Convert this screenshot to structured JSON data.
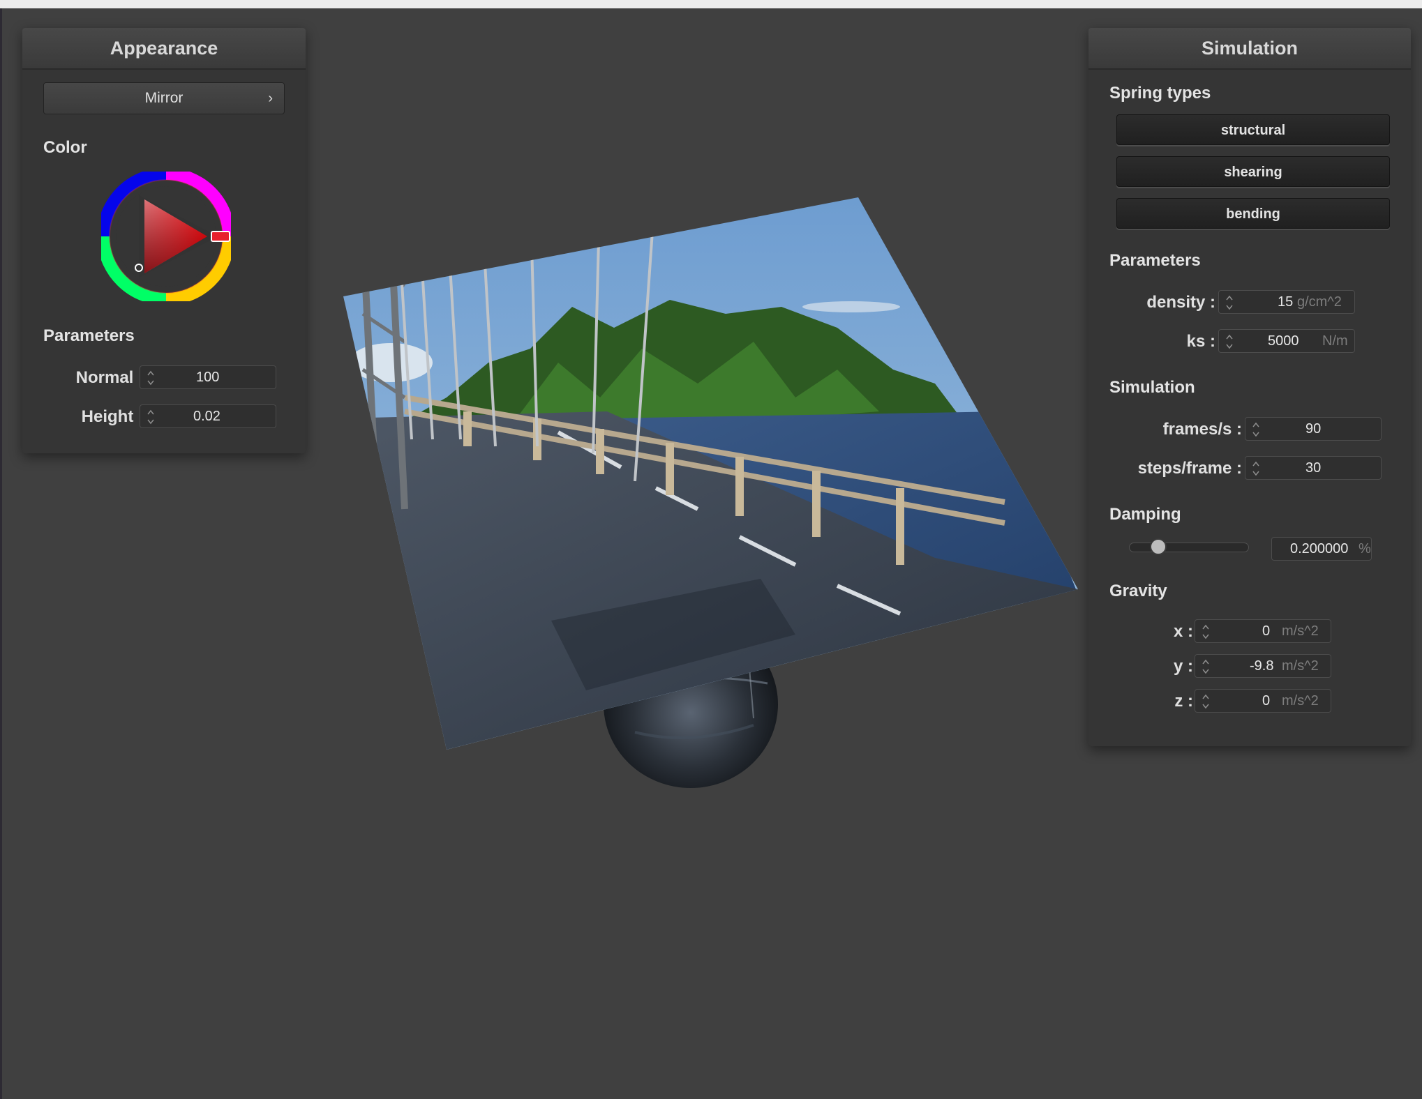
{
  "appearance": {
    "title": "Appearance",
    "material_dropdown": "Mirror",
    "color_label": "Color",
    "selected_color": "#ff0000",
    "parameters_label": "Parameters",
    "normal": {
      "label": "Normal :",
      "value": "100"
    },
    "height": {
      "label": "Height :",
      "value": "0.02"
    }
  },
  "simulation": {
    "title": "Simulation",
    "spring_types_label": "Spring types",
    "spring_buttons": [
      "structural",
      "shearing",
      "bending"
    ],
    "parameters_label": "Parameters",
    "density": {
      "label": "density :",
      "value": "15",
      "unit": "g/cm^2"
    },
    "ks": {
      "label": "ks :",
      "value": "5000",
      "unit": "N/m"
    },
    "sim_label": "Simulation",
    "frames_per_second": {
      "label": "frames/s :",
      "value": "90"
    },
    "steps_per_frame": {
      "label": "steps/frame :",
      "value": "30"
    },
    "damping_label": "Damping",
    "damping": {
      "value": "0.200000",
      "unit": "%",
      "fraction": 0.2
    },
    "gravity_label": "Gravity",
    "gravity": {
      "x": {
        "label": "x :",
        "value": "0",
        "unit": "m/s^2"
      },
      "y": {
        "label": "y :",
        "value": "-9.8",
        "unit": "m/s^2"
      },
      "z": {
        "label": "z :",
        "value": "0",
        "unit": "m/s^2"
      }
    }
  },
  "scene": {
    "cloth_texture": "bridge-photo",
    "sphere_material": "mirror"
  }
}
